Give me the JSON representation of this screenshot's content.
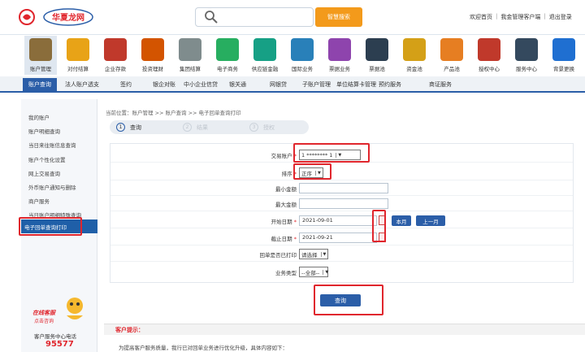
{
  "header": {
    "logo_text": "华夏龙网",
    "search_button": "智慧搜索",
    "links": [
      "欢迎首页",
      "我金管理客户端",
      "退出登录"
    ]
  },
  "nav": {
    "items": [
      "账户管理",
      "对付结算",
      "企业存款",
      "投资理财",
      "集团结算",
      "电子商务",
      "供应链金融",
      "国际业务",
      "票据业务",
      "票据池",
      "资金池",
      "产品池",
      "授权中心",
      "服务中心",
      "背景更换"
    ],
    "colors": [
      "#8a6d3b",
      "#e8a317",
      "#c0392b",
      "#d35400",
      "#7f8c8d",
      "#27ae60",
      "#16a085",
      "#2980b9",
      "#8e44ad",
      "#2c3e50",
      "#d4a017",
      "#e67e22",
      "#c0392b",
      "#34495e",
      "#1f6fd1"
    ]
  },
  "subnav": {
    "active": "账户查询",
    "items": [
      "法人账户透支",
      "签约",
      "银企对账",
      "中小企业信贷",
      "银关通",
      "网银贷",
      "子账户管理",
      "单位结算卡管理",
      "预约服务",
      "商证服务"
    ]
  },
  "sidebar": {
    "items": [
      "我的账户",
      "账户明细查询",
      "当日来往账信息查询",
      "账户个性化设置",
      "网上交易查询",
      "外币账户通知与删除",
      "商户服务",
      "当日账户明细特殊查询"
    ],
    "active": "电子回单查询打印",
    "service_label": "在线客服",
    "service_sub": "点击咨询",
    "hotline_label": "客户服务中心电话",
    "hotline": "95577"
  },
  "main": {
    "breadcrumb": "当前位置：账户管理 >> 账户查询 >> 电子回单查询打印",
    "steps": [
      {
        "num": "1",
        "label": "查询"
      },
      {
        "num": "2",
        "label": "结果"
      },
      {
        "num": "3",
        "label": "授权"
      }
    ],
    "form": {
      "account_label": "交易账户",
      "account_value": "1 ********  1",
      "sort_label": "排序",
      "sort_value": "正序",
      "min_label": "最小金额",
      "max_label": "最大金额",
      "start_label": "开始日期",
      "start_value": "2021-09-01",
      "this_month": "本月",
      "last_month": "上一月",
      "end_label": "截止日期",
      "end_value": "2021-09-21",
      "printed_label": "回单是否已打印",
      "printed_value": "请选择",
      "biz_label": "业务类型",
      "biz_value": "--全部--"
    },
    "query_button": "查询",
    "tip_title": "客户提示：",
    "tip_text": "为提高客户服务质量，我行已对回单业务进行优化升级，具体内容如下："
  }
}
